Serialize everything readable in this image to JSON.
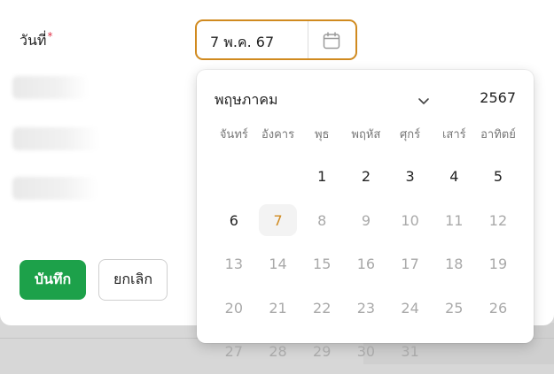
{
  "form": {
    "date_label": "วันที่",
    "required_mark": "*",
    "date_value": "7 พ.ค. 67",
    "save_label": "บันทึก",
    "cancel_label": "ยกเลิก"
  },
  "calendar": {
    "month": "พฤษภาคม",
    "year": "2567",
    "weekdays": [
      "จันทร์",
      "อังคาร",
      "พุธ",
      "พฤหัส",
      "ศุกร์",
      "เสาร์",
      "อาทิตย์"
    ],
    "weeks": [
      [
        {
          "d": "",
          "s": "empty"
        },
        {
          "d": "",
          "s": "empty"
        },
        {
          "d": "1",
          "s": "enabled"
        },
        {
          "d": "2",
          "s": "enabled"
        },
        {
          "d": "3",
          "s": "enabled"
        },
        {
          "d": "4",
          "s": "enabled"
        },
        {
          "d": "5",
          "s": "enabled"
        }
      ],
      [
        {
          "d": "6",
          "s": "enabled"
        },
        {
          "d": "7",
          "s": "selected"
        },
        {
          "d": "8",
          "s": "disabled"
        },
        {
          "d": "9",
          "s": "disabled"
        },
        {
          "d": "10",
          "s": "disabled"
        },
        {
          "d": "11",
          "s": "disabled"
        },
        {
          "d": "12",
          "s": "disabled"
        }
      ],
      [
        {
          "d": "13",
          "s": "disabled"
        },
        {
          "d": "14",
          "s": "disabled"
        },
        {
          "d": "15",
          "s": "disabled"
        },
        {
          "d": "16",
          "s": "disabled"
        },
        {
          "d": "17",
          "s": "disabled"
        },
        {
          "d": "18",
          "s": "disabled"
        },
        {
          "d": "19",
          "s": "disabled"
        }
      ],
      [
        {
          "d": "20",
          "s": "disabled"
        },
        {
          "d": "21",
          "s": "disabled"
        },
        {
          "d": "22",
          "s": "disabled"
        },
        {
          "d": "23",
          "s": "disabled"
        },
        {
          "d": "24",
          "s": "disabled"
        },
        {
          "d": "25",
          "s": "disabled"
        },
        {
          "d": "26",
          "s": "disabled"
        }
      ],
      [
        {
          "d": "27",
          "s": "disabled"
        },
        {
          "d": "28",
          "s": "disabled"
        },
        {
          "d": "29",
          "s": "disabled"
        },
        {
          "d": "30",
          "s": "disabled"
        },
        {
          "d": "31",
          "s": "disabled"
        },
        {
          "d": "",
          "s": "empty"
        },
        {
          "d": "",
          "s": "empty"
        }
      ]
    ]
  },
  "icons": {
    "calendar": "calendar-icon",
    "month_dropdown": "chevron-down-icon"
  },
  "colors": {
    "accent": "#d08a1f",
    "save_button": "#1da14a",
    "required": "#e0344a",
    "disabled_text": "#a9a9a9"
  }
}
